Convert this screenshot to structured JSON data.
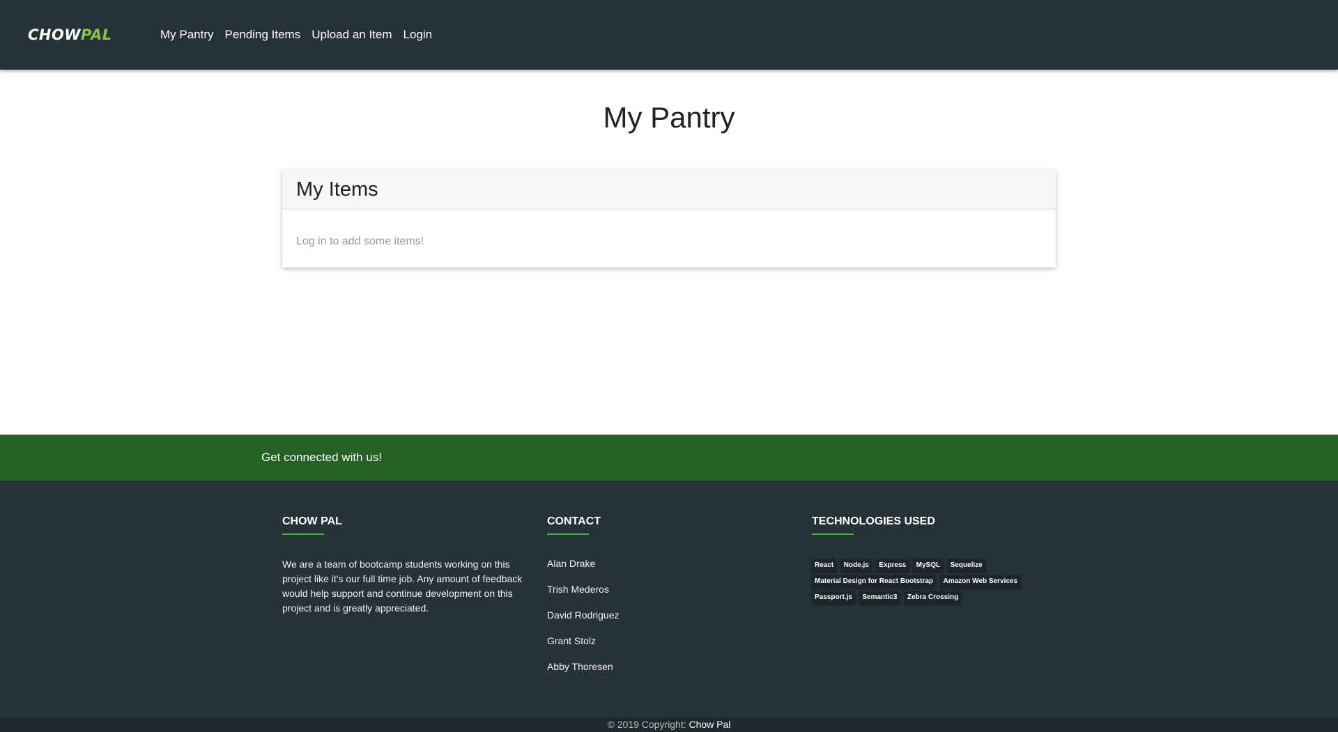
{
  "colors": {
    "navbar_bg": "#263238",
    "social_bg": "#256024",
    "footer_bg": "#263238",
    "accent_green": "#8bc34a",
    "rule_green": "#4caf50"
  },
  "navbar": {
    "logo_icon": "chowpal-logo-icon",
    "logo_text_white": "CHOW",
    "logo_text_green": "PAL",
    "links": [
      "My Pantry",
      "Pending Items",
      "Upload an Item",
      "Login"
    ]
  },
  "main": {
    "title": "My Pantry",
    "card": {
      "header": "My Items",
      "empty_message": "Log in to add some items!"
    }
  },
  "social": {
    "text": "Get connected with us!"
  },
  "footer": {
    "about": {
      "heading": "CHOW PAL",
      "text": "We are a team of bootcamp students working on this project like it's our full time job. Any amount of feedback would help support and continue development on this project and is greatly appreciated."
    },
    "contact": {
      "heading": "CONTACT",
      "names": [
        "Alan Drake",
        "Trish Mederos",
        "David Rodriguez",
        "Grant Stolz",
        "Abby Thoresen"
      ]
    },
    "technologies": {
      "heading": "TECHNOLOGIES USED",
      "tags": [
        "React",
        "Node.js",
        "Express",
        "MySQL",
        "Sequelize",
        "Material Design for React Bootstrap",
        "Amazon Web Services",
        "Passport.js",
        "Semantic3",
        "Zebra Crossing"
      ]
    },
    "copyright_prefix": "© 2019 Copyright:",
    "copyright_link": "Chow Pal"
  }
}
